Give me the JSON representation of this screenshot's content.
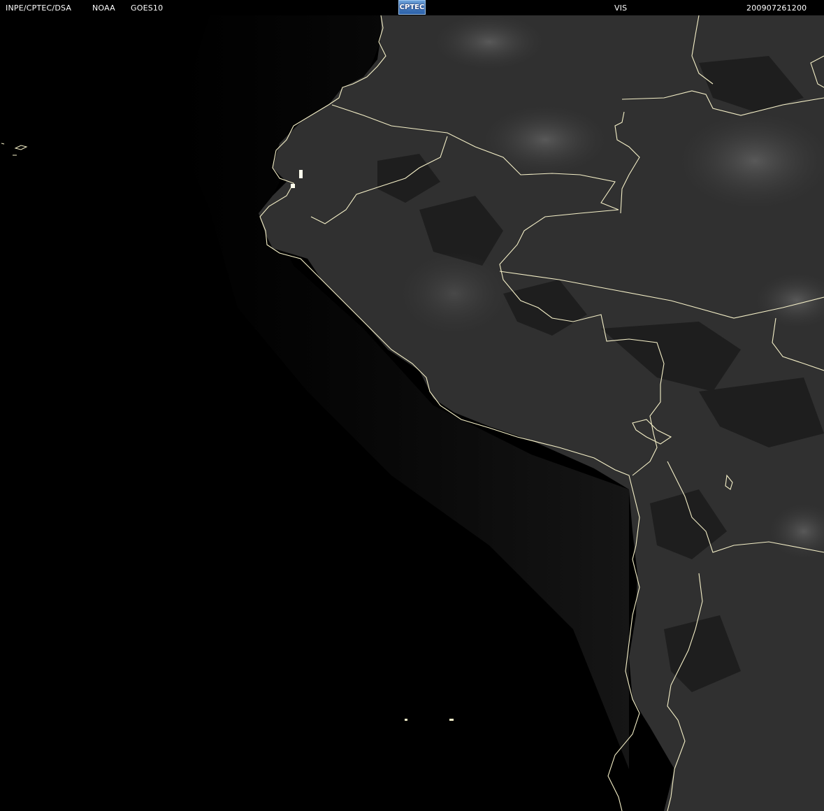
{
  "header": {
    "org": "INPE/CPTEC/DSA",
    "agency": "NOAA",
    "satellite": "GOES10",
    "logo_text": "CPTEC",
    "channel": "VIS",
    "timestamp": "200907261200"
  },
  "image": {
    "type": "satellite visible imagery",
    "background_color": "#000000",
    "land_cloud_color": "#3a3a3a",
    "border_color": "#f5f0c8"
  }
}
